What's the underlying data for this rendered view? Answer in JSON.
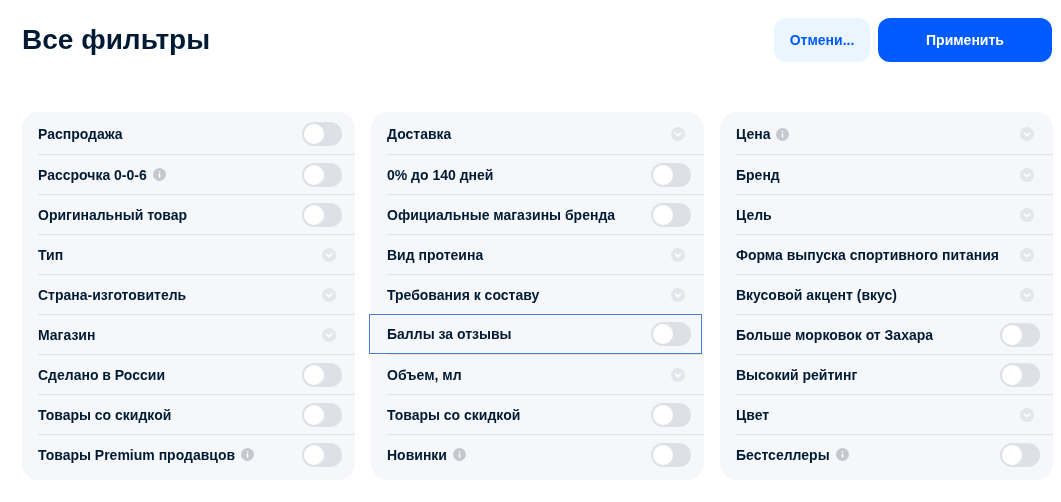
{
  "header": {
    "title": "Все фильтры",
    "cancel_button": "Отмени...",
    "apply_button": "Применить"
  },
  "columns": [
    {
      "items": [
        {
          "label": "Распродажа",
          "kind": "toggle",
          "on": false,
          "info": false,
          "focused": false
        },
        {
          "label": "Рассрочка 0-0-6",
          "kind": "toggle",
          "on": false,
          "info": true,
          "focused": false
        },
        {
          "label": "Оригинальный товар",
          "kind": "toggle",
          "on": false,
          "info": false,
          "focused": false
        },
        {
          "label": "Тип",
          "kind": "dropdown",
          "info": false,
          "focused": false
        },
        {
          "label": "Страна-изготовитель",
          "kind": "dropdown",
          "info": false,
          "focused": false
        },
        {
          "label": "Магазин",
          "kind": "dropdown",
          "info": false,
          "focused": false
        },
        {
          "label": "Сделано в России",
          "kind": "toggle",
          "on": false,
          "info": false,
          "focused": false
        },
        {
          "label": "Товары со скидкой",
          "kind": "toggle",
          "on": false,
          "info": false,
          "focused": false
        },
        {
          "label": "Товары Premium продавцов",
          "kind": "toggle",
          "on": false,
          "info": true,
          "focused": false
        }
      ]
    },
    {
      "items": [
        {
          "label": "Доставка",
          "kind": "dropdown",
          "info": false,
          "focused": false
        },
        {
          "label": "0% до 140 дней",
          "kind": "toggle",
          "on": false,
          "info": false,
          "focused": false
        },
        {
          "label": "Официальные магазины бренда",
          "kind": "toggle",
          "on": false,
          "info": false,
          "focused": false
        },
        {
          "label": "Вид протеина",
          "kind": "dropdown",
          "info": false,
          "focused": false
        },
        {
          "label": "Требования к составу",
          "kind": "dropdown",
          "info": false,
          "focused": false
        },
        {
          "label": "Баллы за отзывы",
          "kind": "toggle",
          "on": false,
          "info": false,
          "focused": true
        },
        {
          "label": "Объем, мл",
          "kind": "dropdown",
          "info": false,
          "focused": false
        },
        {
          "label": "Товары со скидкой",
          "kind": "toggle",
          "on": false,
          "info": false,
          "focused": false
        },
        {
          "label": "Новинки",
          "kind": "toggle",
          "on": false,
          "info": true,
          "focused": false
        }
      ]
    },
    {
      "items": [
        {
          "label": "Цена",
          "kind": "dropdown",
          "info": true,
          "focused": false
        },
        {
          "label": "Бренд",
          "kind": "dropdown",
          "info": false,
          "focused": false
        },
        {
          "label": "Цель",
          "kind": "dropdown",
          "info": false,
          "focused": false
        },
        {
          "label": "Форма выпуска спортивного питания",
          "kind": "dropdown",
          "info": false,
          "focused": false
        },
        {
          "label": "Вкусовой акцент (вкус)",
          "kind": "dropdown",
          "info": false,
          "focused": false
        },
        {
          "label": "Больше морковок от Захара",
          "kind": "toggle",
          "on": false,
          "info": false,
          "focused": false
        },
        {
          "label": "Высокий рейтинг",
          "kind": "toggle",
          "on": false,
          "info": false,
          "focused": false
        },
        {
          "label": "Цвет",
          "kind": "dropdown",
          "info": false,
          "focused": false
        },
        {
          "label": "Бестселлеры",
          "kind": "toggle",
          "on": false,
          "info": true,
          "focused": false
        }
      ]
    }
  ]
}
